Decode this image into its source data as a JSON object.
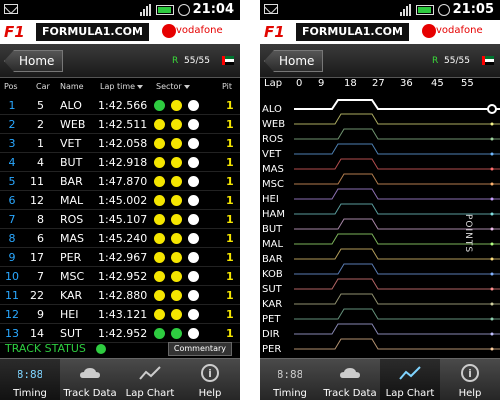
{
  "statusbar_left": {
    "time": "21:04"
  },
  "statusbar_right": {
    "time": "21:05"
  },
  "brand": {
    "logo": "F1",
    "wordmark": "FORMULA1.COM",
    "sponsor": "vodafone"
  },
  "nav": {
    "home_label": "Home",
    "race_indicator": "R",
    "lap_counter": "55/55"
  },
  "timing": {
    "headers": {
      "pos": "Pos",
      "car": "Car",
      "name": "Name",
      "lap_time": "Lap time",
      "sector": "Sector",
      "pit": "Pit"
    },
    "rows": [
      {
        "pos": "1",
        "car": "5",
        "name": "ALO",
        "time": "1:42.566",
        "sectors": [
          "green",
          "yellow",
          "white"
        ],
        "pit": "1"
      },
      {
        "pos": "2",
        "car": "2",
        "name": "WEB",
        "time": "1:42.511",
        "sectors": [
          "yellow",
          "yellow",
          "white"
        ],
        "pit": "1"
      },
      {
        "pos": "3",
        "car": "1",
        "name": "VET",
        "time": "1:42.058",
        "sectors": [
          "yellow",
          "yellow",
          "white"
        ],
        "pit": "1"
      },
      {
        "pos": "4",
        "car": "4",
        "name": "BUT",
        "time": "1:42.918",
        "sectors": [
          "yellow",
          "yellow",
          "white"
        ],
        "pit": "1"
      },
      {
        "pos": "5",
        "car": "11",
        "name": "BAR",
        "time": "1:47.870",
        "sectors": [
          "yellow",
          "yellow",
          "white"
        ],
        "pit": "1"
      },
      {
        "pos": "6",
        "car": "12",
        "name": "MAL",
        "time": "1:45.002",
        "sectors": [
          "yellow",
          "yellow",
          "white"
        ],
        "pit": "1"
      },
      {
        "pos": "7",
        "car": "8",
        "name": "ROS",
        "time": "1:45.107",
        "sectors": [
          "yellow",
          "yellow",
          "white"
        ],
        "pit": "1"
      },
      {
        "pos": "8",
        "car": "6",
        "name": "MAS",
        "time": "1:45.240",
        "sectors": [
          "yellow",
          "yellow",
          "white"
        ],
        "pit": "1"
      },
      {
        "pos": "9",
        "car": "17",
        "name": "PER",
        "time": "1:42.967",
        "sectors": [
          "yellow",
          "yellow",
          "white"
        ],
        "pit": "1"
      },
      {
        "pos": "10",
        "car": "7",
        "name": "MSC",
        "time": "1:42.952",
        "sectors": [
          "yellow",
          "yellow",
          "white"
        ],
        "pit": "1"
      },
      {
        "pos": "11",
        "car": "22",
        "name": "KAR",
        "time": "1:42.880",
        "sectors": [
          "yellow",
          "yellow",
          "white"
        ],
        "pit": "1"
      },
      {
        "pos": "12",
        "car": "9",
        "name": "HEI",
        "time": "1:43.121",
        "sectors": [
          "yellow",
          "yellow",
          "white"
        ],
        "pit": "1"
      },
      {
        "pos": "13",
        "car": "14",
        "name": "SUT",
        "time": "1:42.952",
        "sectors": [
          "green",
          "green",
          "white"
        ],
        "pit": "1"
      }
    ]
  },
  "track_status": {
    "label": "TRACK STATUS",
    "color": "#2ecc40",
    "commentary_label": "Commentary"
  },
  "tabs": [
    {
      "label": "Timing",
      "icon": "clock-icon",
      "active": true
    },
    {
      "label": "Track Data",
      "icon": "weather-icon",
      "active": false
    },
    {
      "label": "Lap Chart",
      "icon": "lap-chart-icon",
      "active": false
    },
    {
      "label": "Help",
      "icon": "info-icon",
      "active": false
    }
  ],
  "tabs_right": [
    {
      "label": "Timing",
      "icon": "clock-icon",
      "active": false
    },
    {
      "label": "Track Data",
      "icon": "weather-icon",
      "active": false
    },
    {
      "label": "Lap Chart",
      "icon": "lap-chart-icon",
      "active": true
    },
    {
      "label": "Help",
      "icon": "info-icon",
      "active": false
    }
  ],
  "lapchart": {
    "header_label": "Lap",
    "lap_ticks": [
      "0",
      "9",
      "18",
      "27",
      "36",
      "45",
      "55"
    ],
    "drivers": [
      "ALO",
      "WEB",
      "ROS",
      "VET",
      "MAS",
      "MSC",
      "HEI",
      "HAM",
      "BUT",
      "MAL",
      "BAR",
      "KOB",
      "SUT",
      "KAR",
      "PET",
      "DIR",
      "PER"
    ],
    "points_label": "POINTS",
    "colors": {
      "highlight": "#ffffff",
      "sector_green": "#2ecc40",
      "sector_yellow": "#f5e600",
      "pos_blue": "#2aa8ff"
    }
  }
}
